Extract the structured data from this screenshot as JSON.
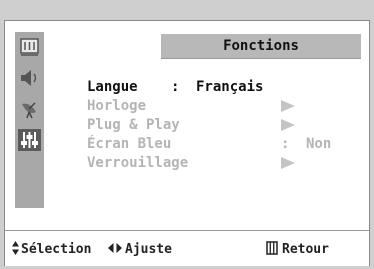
{
  "menu": {
    "title": "Fonctions",
    "items": [
      {
        "label": "Langue",
        "separator": ":",
        "value": "Français",
        "state": "active"
      },
      {
        "label": "Horloge",
        "state": "dim",
        "has_submenu": true
      },
      {
        "label": "Plug & Play",
        "state": "dim",
        "has_submenu": true
      },
      {
        "label": "Écran Bleu",
        "separator": ":",
        "value": "Non",
        "state": "dim"
      },
      {
        "label": "Verrouillage",
        "state": "dim",
        "has_submenu": true
      }
    ]
  },
  "sidebar": {
    "icons": [
      {
        "name": "picture-icon",
        "active": false
      },
      {
        "name": "speaker-icon",
        "active": false
      },
      {
        "name": "satellite-dish-icon",
        "active": false
      },
      {
        "name": "setup-sliders-icon",
        "active": true
      }
    ]
  },
  "footer": {
    "select_label": "Sélection",
    "adjust_label": "Ajuste",
    "return_label": "Retour"
  },
  "colors": {
    "active_text": "#111111",
    "dim_text": "#b4b4b4",
    "title_bar": "#b8b8b8",
    "sidebar": "#a8a8a8"
  }
}
